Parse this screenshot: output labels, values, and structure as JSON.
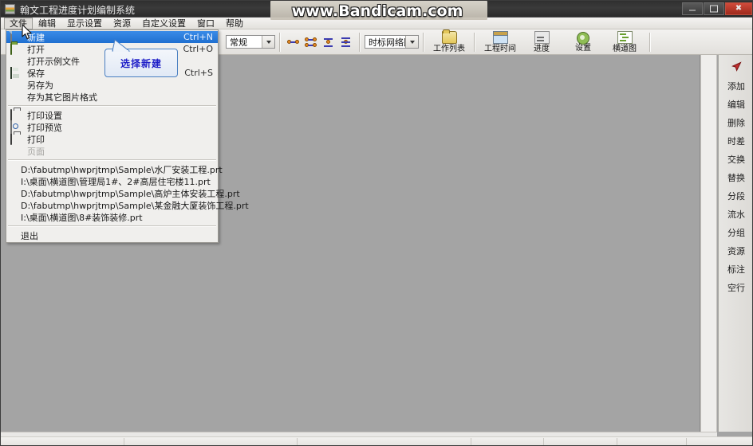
{
  "window": {
    "title": "翰文工程进度计划编制系统",
    "icon": "app-icon",
    "controls": {
      "minimize": "minimize-icon",
      "maximize": "maximize-icon",
      "close": "close-icon"
    }
  },
  "watermark": {
    "text": "www.Bandicam.com"
  },
  "menubar": {
    "items": [
      {
        "label": "文件",
        "active": true
      },
      {
        "label": "编辑",
        "active": false
      },
      {
        "label": "显示设置",
        "active": false
      },
      {
        "label": "资源",
        "active": false
      },
      {
        "label": "自定义设置",
        "active": false
      },
      {
        "label": "窗口",
        "active": false
      },
      {
        "label": "帮助",
        "active": false
      }
    ]
  },
  "toolbar": {
    "view_combo": {
      "value": "常规"
    },
    "type_combo": {
      "value": "时标网络图"
    },
    "icon_buttons": [
      {
        "name": "network-link-icon"
      },
      {
        "name": "network-double-link-icon"
      },
      {
        "name": "network-vertical-icon"
      },
      {
        "name": "network-stack-icon"
      }
    ],
    "buttons": [
      {
        "label": "工作列表",
        "icon": "folder-icon"
      },
      {
        "label": "工程时间",
        "icon": "window-icon"
      },
      {
        "label": "进度",
        "icon": "chart-icon"
      },
      {
        "label": "设置",
        "icon": "gear-icon"
      },
      {
        "label": "横道图",
        "icon": "gantt-icon"
      }
    ]
  },
  "file_menu": {
    "items": [
      {
        "label": "新建",
        "accel": "Ctrl+N",
        "icon": "new-file-icon",
        "highlight": true,
        "disabled": false
      },
      {
        "label": "打开",
        "accel": "Ctrl+O",
        "icon": "open-folder-icon",
        "highlight": false,
        "disabled": false
      },
      {
        "label": "打开示例文件",
        "accel": "",
        "icon": "",
        "highlight": false,
        "disabled": false
      },
      {
        "label": "保存",
        "accel": "Ctrl+S",
        "icon": "save-icon",
        "highlight": false,
        "disabled": false
      },
      {
        "label": "另存为",
        "accel": "",
        "icon": "",
        "highlight": false,
        "disabled": false
      },
      {
        "label": "存为其它图片格式",
        "accel": "",
        "icon": "",
        "highlight": false,
        "disabled": false
      }
    ],
    "print_items": [
      {
        "label": "打印设置",
        "accel": "",
        "icon": "printer-setup-icon",
        "disabled": false
      },
      {
        "label": "打印预览",
        "accel": "",
        "icon": "print-preview-icon",
        "disabled": false
      },
      {
        "label": "打印",
        "accel": "",
        "icon": "printer-icon",
        "disabled": false
      },
      {
        "label": "页面",
        "accel": "",
        "icon": "",
        "disabled": true
      }
    ],
    "recent_files": [
      "D:\\fabutmp\\hwprjtmp\\Sample\\水厂安装工程.prt",
      "I:\\桌面\\横道图\\管理局1#、2#高层住宅楼11.prt",
      "D:\\fabutmp\\hwprjtmp\\Sample\\高炉主体安装工程.prt",
      "D:\\fabutmp\\hwprjtmp\\Sample\\某金融大厦装饰工程.prt",
      "I:\\桌面\\横道图\\8#装饰装修.prt"
    ],
    "exit": {
      "label": "退出"
    }
  },
  "callout": {
    "text": "选择新建"
  },
  "right_panel": {
    "cursor_tool": "arrow-cursor-icon",
    "items": [
      {
        "label": "添加"
      },
      {
        "label": "编辑"
      },
      {
        "label": "删除"
      },
      {
        "label": "时差"
      },
      {
        "label": "交换"
      },
      {
        "label": "替换"
      },
      {
        "label": "分段"
      },
      {
        "label": "流水"
      },
      {
        "label": "分组"
      },
      {
        "label": "资源"
      },
      {
        "label": "标注"
      },
      {
        "label": "空行"
      }
    ]
  },
  "statusbar": {
    "cells": [
      "",
      "",
      "",
      "",
      "",
      "",
      ""
    ]
  },
  "colors": {
    "canvas": "#a4a4a4",
    "titlebar": "#333333",
    "menu_highlight": "#2e7fdc",
    "callout_text": "#2020c8",
    "close_button": "#c2402f"
  }
}
